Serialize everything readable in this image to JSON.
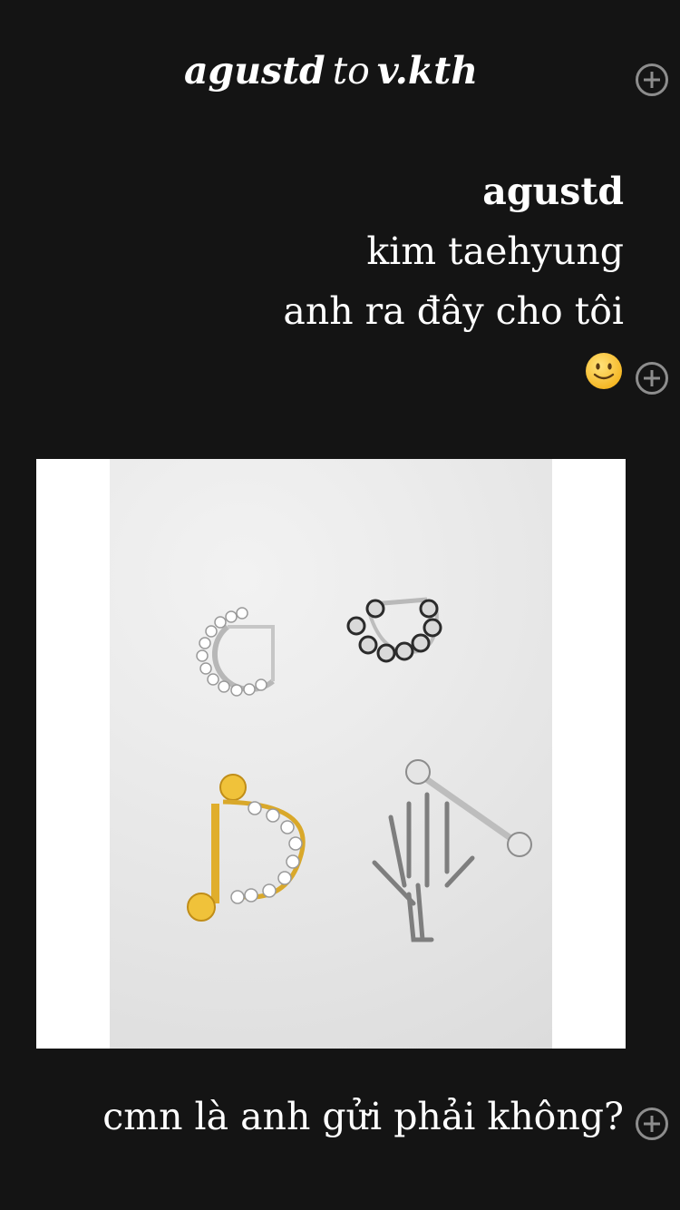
{
  "header": {
    "sender": "agustd",
    "connector": "to",
    "recipient": "v.kth"
  },
  "messages": {
    "sender": "agustd",
    "lines": [
      "kim taehyung",
      "anh ra đây cho tôi"
    ],
    "emoji": "slightly-smiling-face"
  },
  "photo": {
    "description_icon": "piercing-jewelry-photo"
  },
  "bottom_message": "cmn là anh gửi phải không?",
  "colors": {
    "background": "#141414",
    "text": "#ffffff",
    "plus_icon": "#8d8d8d",
    "photo_frame": "#ffffff"
  }
}
